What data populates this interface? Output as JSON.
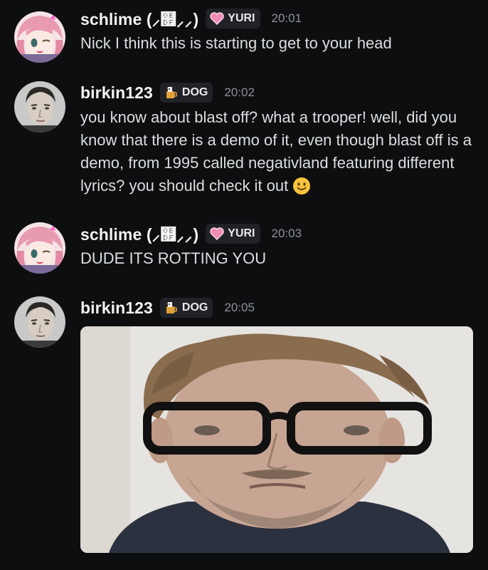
{
  "messages": [
    {
      "username": "schlime (⸝௟⸝⸝)",
      "role": "YURI",
      "time": "20:01",
      "text": "Nick I think this is starting to get to your head"
    },
    {
      "username": "birkin123",
      "role": "DOG",
      "time": "20:02",
      "text": "you know about blast off? what a trooper! well, did you know that there is a demo of it, even though blast off is a demo, from 1995 called negativland featuring different lyrics? you should check it out",
      "emoji": "slightly-smiling-face-icon"
    },
    {
      "username": "schlime (⸝௟⸝⸝)",
      "role": "YURI",
      "time": "20:03",
      "text": "DUDE ITS ROTTING YOU"
    },
    {
      "username": "birkin123",
      "role": "DOG",
      "time": "20:05",
      "attachment": "image-attachment"
    }
  ],
  "colors": {
    "background": "#0d0e10",
    "username": "#f2f3f5",
    "text": "#dbdee1",
    "timestamp": "#8e9297",
    "tag_bg": "#202227"
  },
  "icons": {
    "yuri_role": "pink-heart-icon",
    "dog_role": "dog-mug-icon"
  }
}
